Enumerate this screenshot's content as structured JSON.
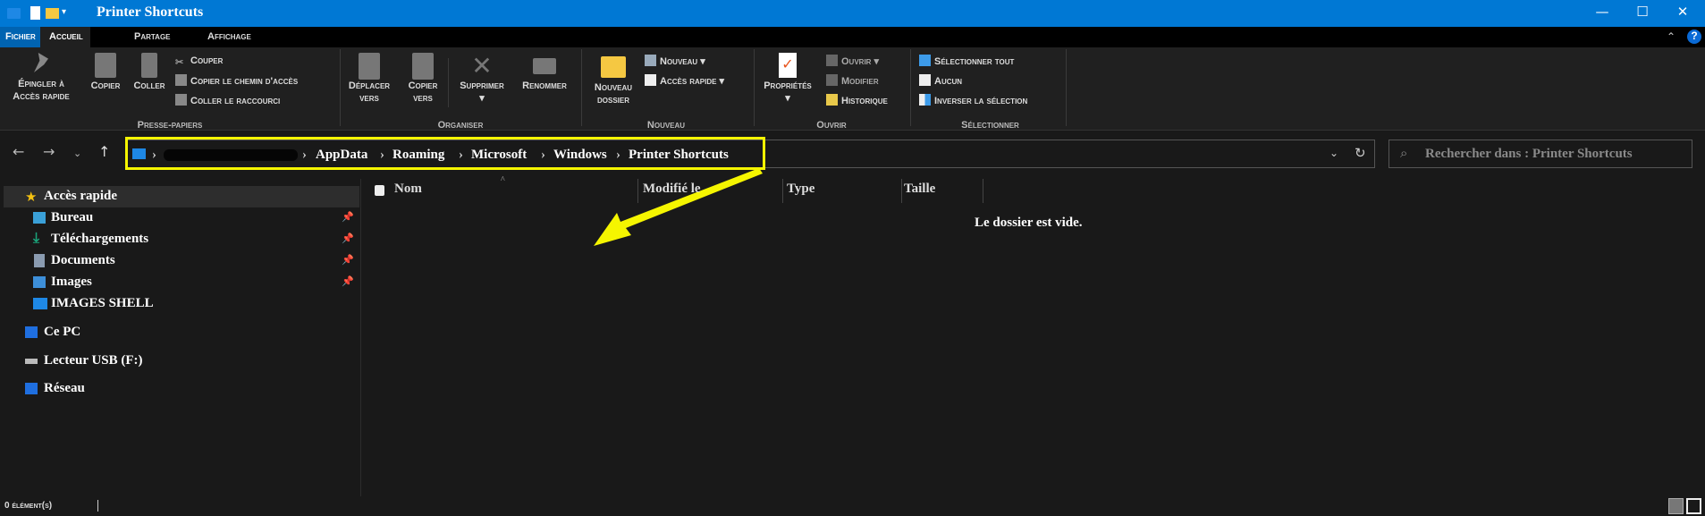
{
  "window": {
    "title": "Printer Shortcuts",
    "minimize": "—",
    "maximize": "☐",
    "close": "✕"
  },
  "tabs": [
    {
      "label": "Fichier"
    },
    {
      "label": "Accueil"
    },
    {
      "label": "Partage"
    },
    {
      "label": "Affichage"
    }
  ],
  "ribbon": {
    "pin": "Épingler à",
    "pin2": "Accès rapide",
    "copy": "Copier",
    "paste": "Coller",
    "cut": "Couper",
    "copy_path": "Copier le chemin d'accès",
    "paste_shortcut": "Coller le raccourci",
    "group_clipboard": "Presse-papiers",
    "move_to": "Déplacer",
    "move_to2": "vers",
    "copy_to": "Copier",
    "copy_to2": "vers",
    "delete": "Supprimer",
    "rename": "Renommer",
    "group_organize": "Organiser",
    "new_folder": "Nouveau",
    "new_folder2": "dossier",
    "new_item": "Nouveau",
    "easy_access": "Accès rapide",
    "group_new": "Nouveau",
    "properties": "Propriétés",
    "open": "Ouvrir",
    "edit": "Modifier",
    "history": "Historique",
    "group_open": "Ouvrir",
    "select_all": "Sélectionner tout",
    "select_none": "Aucun",
    "invert": "Inverser la sélection",
    "group_select": "Sélectionner"
  },
  "address": {
    "crumbs": [
      "AppData",
      "Roaming",
      "Microsoft",
      "Windows",
      "Printer Shortcuts"
    ],
    "search_placeholder": "Rechercher dans : Printer Shortcuts"
  },
  "sidebar": {
    "items": [
      {
        "label": "Accès rapide",
        "icon": "star-icon",
        "color": "#f5c211"
      },
      {
        "label": "Bureau",
        "icon": "desktop-icon",
        "color": "#3aa0d8"
      },
      {
        "label": "Téléchargements",
        "icon": "download-icon",
        "color": "#1aa37a"
      },
      {
        "label": "Documents",
        "icon": "documents-icon",
        "color": "#8a9bb0"
      },
      {
        "label": "Images",
        "icon": "pictures-icon",
        "color": "#3d8fd9"
      },
      {
        "label": "IMAGES SHELL",
        "icon": "folder-icon",
        "color": "#1e88e5"
      },
      {
        "label": "Ce PC",
        "icon": "pc-icon",
        "color": "#1f6fe0"
      },
      {
        "label": "Lecteur USB (F:)",
        "icon": "usb-drive-icon",
        "color": "#bbbbbb"
      },
      {
        "label": "Réseau",
        "icon": "network-icon",
        "color": "#1f6fe0"
      }
    ]
  },
  "columns": [
    "Nom",
    "Modifié le",
    "Type",
    "Taille"
  ],
  "empty_message": "Le dossier est vide.",
  "status": {
    "count": "0 élément(s)"
  },
  "colors": {
    "accent": "#0078d4",
    "highlight": "#f5f500"
  }
}
